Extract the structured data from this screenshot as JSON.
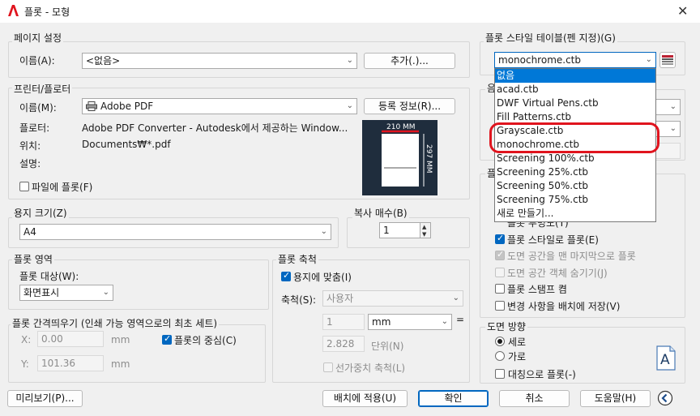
{
  "window": {
    "title": "플롯 - 모형"
  },
  "page_setup": {
    "group_label": "페이지 설정",
    "name_label": "이름(A):",
    "name_value": "<없음>",
    "add_button": "추가(.)..."
  },
  "printer": {
    "group_label": "프린터/플로터",
    "name_label": "이름(M):",
    "name_value": "Adobe PDF",
    "properties_button": "등록 정보(R)...",
    "plotter_label": "플로터:",
    "plotter_value": "Adobe PDF Converter - Autodesk에서 제공하는 Window...",
    "where_label": "위치:",
    "where_value": "Documents₩*.pdf",
    "description_label": "설명:",
    "plot_to_file_label": "파일에 플롯(F)",
    "plot_to_file_checked": false,
    "preview_width": "210 MM",
    "preview_height": "297 MM"
  },
  "paper_size": {
    "group_label": "용지 크기(Z)",
    "value": "A4"
  },
  "copies": {
    "group_label": "복사 매수(B)",
    "value": "1"
  },
  "plot_area": {
    "group_label": "플롯 영역",
    "what_label": "플롯 대상(W):",
    "what_value": "화면표시"
  },
  "plot_offset": {
    "group_label": "플롯 간격띄우기 (인쇄 가능 영역으로의 최초 세트)",
    "x_label": "X:",
    "x_value": "0.00",
    "y_label": "Y:",
    "y_value": "101.36",
    "unit": "mm",
    "center_label": "플롯의 중심(C)",
    "center_checked": true
  },
  "plot_scale": {
    "group_label": "플롯 축척",
    "fit_label": "용지에 맞춤(I)",
    "fit_checked": true,
    "scale_label": "축척(S):",
    "scale_value": "사용자",
    "value1": "1",
    "unit_value": "mm",
    "equals": "=",
    "value2": "2.828",
    "unit_label": "단위(N)",
    "lineweights_label": "선가중치 축척(L)"
  },
  "plot_style_table": {
    "group_label": "플롯 스타일 테이블(펜 지정)(G)",
    "value": "monochrome.ctb",
    "items": [
      "없음",
      "acad.ctb",
      "DWF Virtual Pens.ctb",
      "Fill Patterns.ctb",
      "Grayscale.ctb",
      "monochrome.ctb",
      "Screening 100%.ctb",
      "Screening 25%.ctb",
      "Screening 50%.ctb",
      "Screening 75%.ctb",
      "새로 만들기..."
    ],
    "selected_index": 0
  },
  "right_partial": {
    "label_shaded": "음",
    "label_plot_options": "플",
    "hidden_option_text": "플롯 투명도(T)"
  },
  "plot_options": {
    "plot_with_styles": "플롯 스타일로 플롯(E)",
    "plot_with_styles_checked": true,
    "paperspace_last": "도면 공간을 맨 마지막으로 플롯",
    "paperspace_last_checked": true,
    "hide_objects": "도면 공간 객체 숨기기(J)",
    "hide_objects_checked": false,
    "stamp_on": "플롯 스탬프 켬",
    "stamp_on_checked": false,
    "save_changes": "변경 사항을 배치에 저장(V)",
    "save_changes_checked": false
  },
  "orientation": {
    "group_label": "도면 방향",
    "portrait": "세로",
    "landscape": "가로",
    "upside_down": "대칭으로 플롯(-)",
    "selected": "portrait",
    "upside_down_checked": false,
    "page_icon_letter": "A"
  },
  "footer": {
    "preview": "미리보기(P)...",
    "apply": "배치에 적용(U)",
    "ok": "확인",
    "cancel": "취소",
    "help": "도움말(H)"
  },
  "colors": {
    "accent": "#0067c0",
    "highlight": "#0078d7",
    "annotation": "#e0141e"
  }
}
